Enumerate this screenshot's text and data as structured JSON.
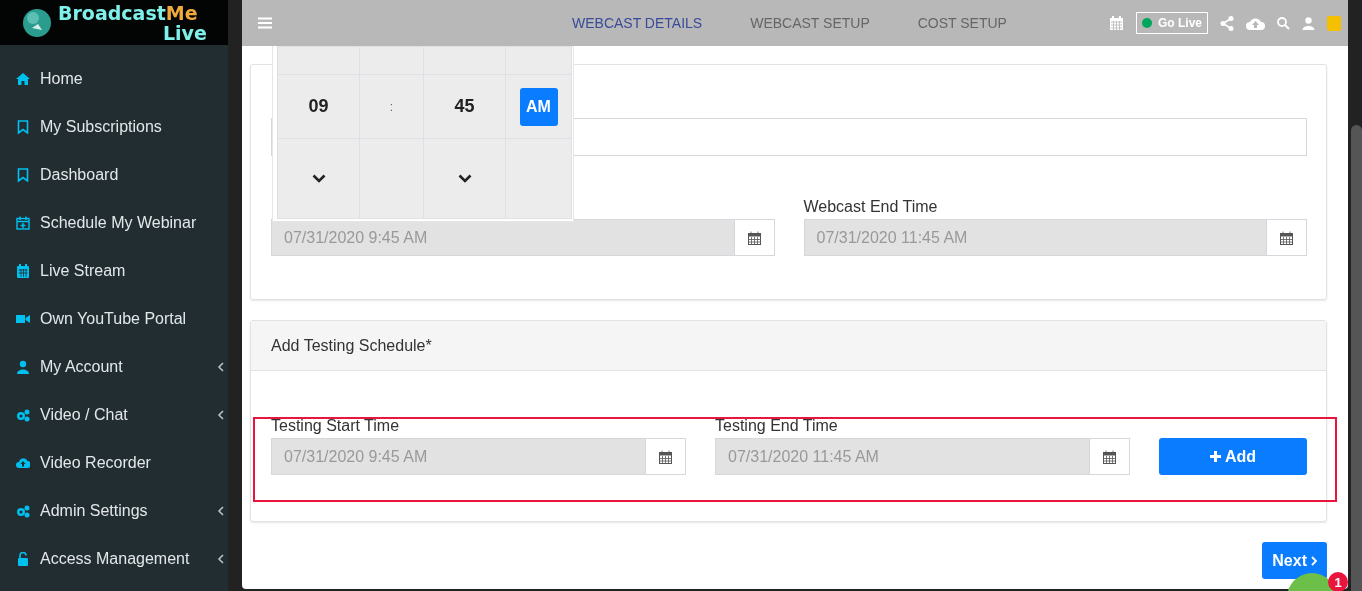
{
  "logo": {
    "part_1": "Broadcast",
    "part_2": "Me",
    "part_3": "Live"
  },
  "sidebar": {
    "items": [
      {
        "label": "Home",
        "kind": "home",
        "has_submenu": false
      },
      {
        "label": "My Subscriptions",
        "kind": "bookmark",
        "has_submenu": false
      },
      {
        "label": "Dashboard",
        "kind": "bookmark",
        "has_submenu": false
      },
      {
        "label": "Schedule My Webinar",
        "kind": "schedule",
        "has_submenu": false
      },
      {
        "label": "Live Stream",
        "kind": "calendar",
        "has_submenu": false
      },
      {
        "label": "Own YouTube Portal",
        "kind": "video",
        "has_submenu": false
      },
      {
        "label": "My Account",
        "kind": "user",
        "has_submenu": true
      },
      {
        "label": "Video / Chat",
        "kind": "gears",
        "has_submenu": true
      },
      {
        "label": "Video Recorder",
        "kind": "cloud",
        "has_submenu": false
      },
      {
        "label": "Admin Settings",
        "kind": "gears",
        "has_submenu": true
      },
      {
        "label": "Access Management",
        "kind": "unlock",
        "has_submenu": true
      }
    ]
  },
  "tabs": [
    {
      "label": "WEBCAST DETAILS",
      "selected": true
    },
    {
      "label": "WEBCAST SETUP",
      "selected": false
    },
    {
      "label": "COST SETUP",
      "selected": false
    }
  ],
  "toolbar": {
    "go_live": "Go Live"
  },
  "time_picker": {
    "hour": "09",
    "separator": ":",
    "minute": "45",
    "periods": [
      {
        "label": "AM",
        "selected": true
      }
    ]
  },
  "webcast_card": {
    "fields": [
      {
        "value": "07/31/2020 9:45 AM"
      },
      {
        "label": "Webcast End Time",
        "value": "07/31/2020 11:45 AM"
      }
    ]
  },
  "testing_card": {
    "title": "Add Testing Schedule*",
    "fields": [
      {
        "label": "Testing Start Time",
        "value": "07/31/2020 9:45 AM"
      },
      {
        "label": "Testing End Time",
        "value": "07/31/2020 11:45 AM"
      }
    ],
    "add_button": "Add"
  },
  "next_button": "Next",
  "chat_badge": "1"
}
